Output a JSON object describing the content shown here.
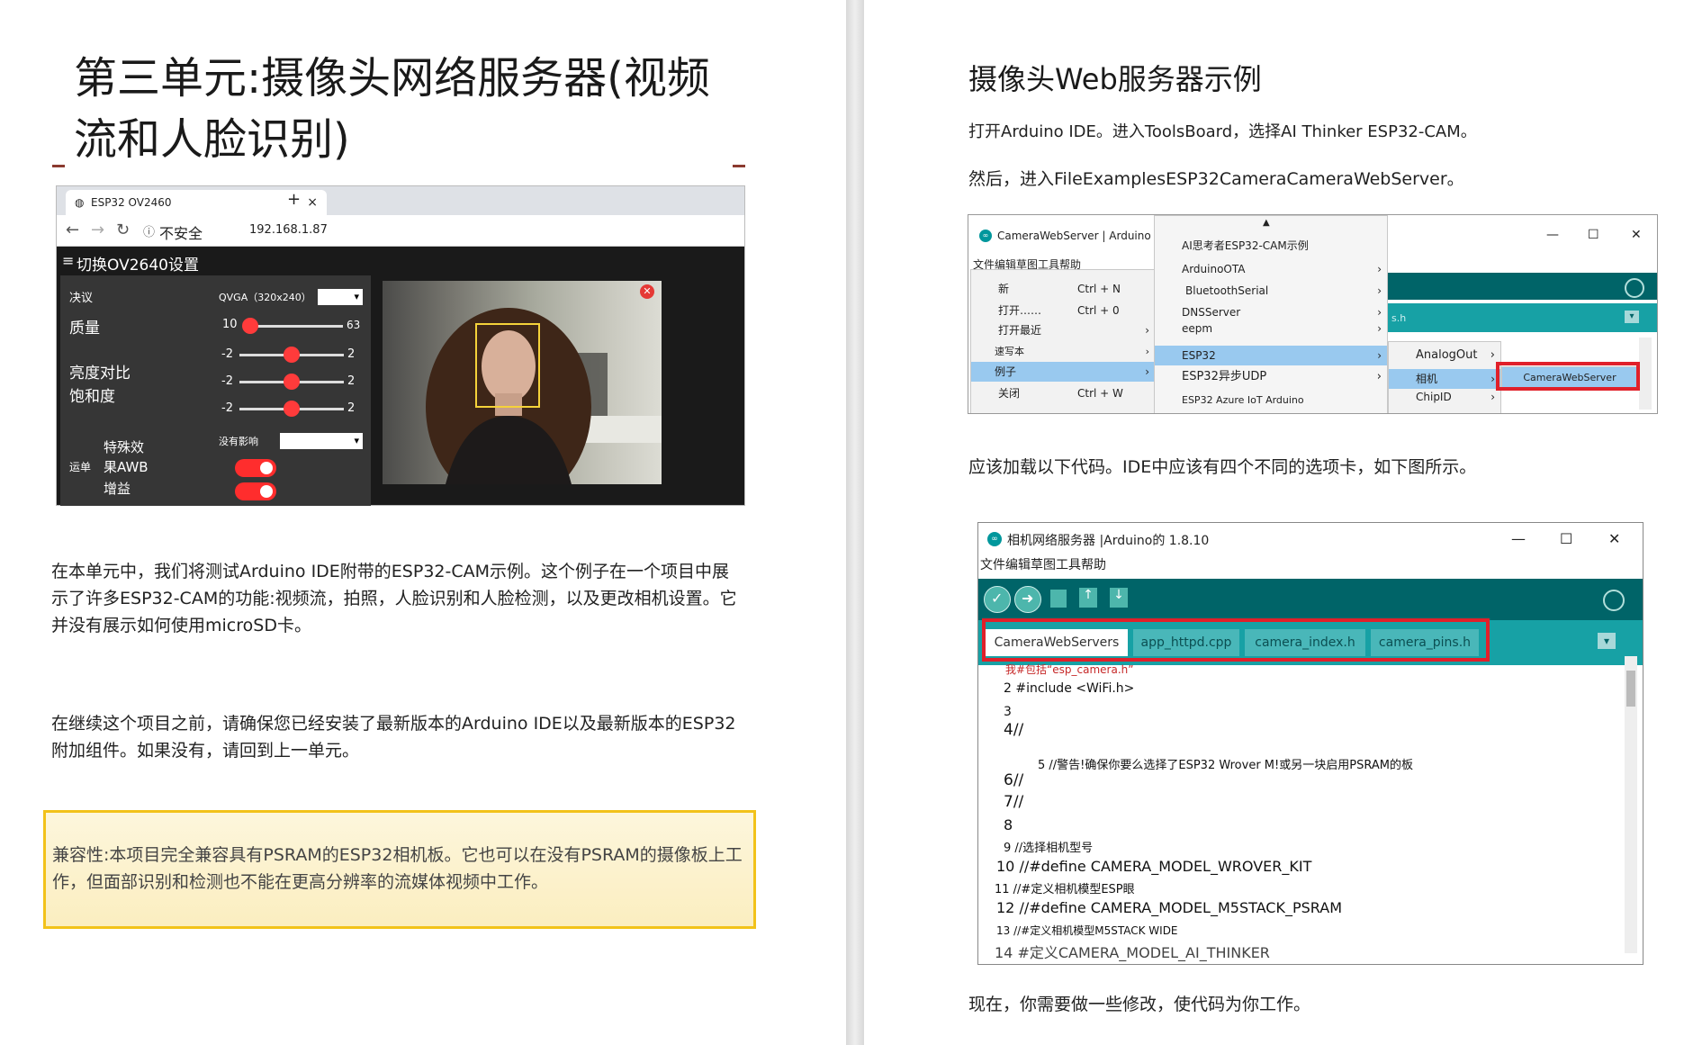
{
  "left": {
    "title_line1": "第三单元:摄像头网络服务器(视频",
    "title_line2": "流和人脸识别)",
    "browser": {
      "tab_title": "ESP32 OV2460",
      "tab_close": "×",
      "tab_add": "+",
      "security_label": "不安全",
      "url": "192.168.1.87",
      "settings_header": "切换OV2640设置",
      "labels": {
        "resolution": "决议",
        "quality": "质量",
        "brightness_contrast": "亮度对比",
        "saturation": "饱和度",
        "special_effects": "特殊效",
        "awb": "果AWB",
        "gain": "增益",
        "side_note": "运单"
      },
      "resolution_value": "QVGA（320x240）",
      "quality_min": "10",
      "quality_max": "63",
      "range_min": "-2",
      "range_max": "2",
      "effect_value": "没有影响",
      "quality_level": 0.05,
      "brightness_level": 0.5,
      "contrast_level": 0.5,
      "saturation_level": 0.5
    },
    "para1": "在本单元中，我们将测试Arduino IDE附带的ESP32-CAM示例。这个例子在一个项目中展示了许多ESP32-CAM的功能:视频流，拍照，人脸识别和人脸检测，以及更改相机设置。它并没有展示如何使用microSD卡。",
    "para2": "在继续这个项目之前，请确保您已经安装了最新版本的Arduino IDE以及最新版本的ESP32附加组件。如果没有，请回到上一单元。",
    "note": "兼容性:本项目完全兼容具有PSRAM的ESP32相机板。它也可以在没有PSRAM的摄像板上工作，但面部识别和检测也不能在更高分辨率的流媒体视频中工作。"
  },
  "right": {
    "title": "摄像头Web服务器示例",
    "step1": "打开Arduino IDE。进入ToolsBoard，选择AI Thinker ESP32-CAM。",
    "step2": "然后，进入FileExamplesESP32CameraCameraWebServer。",
    "ide1": {
      "window_title": "CameraWebServer | Arduino 1 .",
      "menubar": "文件编辑草图工具帮助",
      "file_menu": [
        {
          "label": "新",
          "shortcut": "Ctrl + N"
        },
        {
          "label": "打开……",
          "shortcut": "Ctrl + 0"
        },
        {
          "label": "打开最近",
          "shortcut": ""
        },
        {
          "label": "速写本",
          "shortcut": ""
        },
        {
          "label": "例子",
          "shortcut": ""
        },
        {
          "label": "关闭",
          "shortcut": "Ctrl + W"
        }
      ],
      "examples_menu": [
        "AI思考者ESP32-CAM示例",
        "ArduinoOTA",
        "BluetoothSerial",
        "DNSServer",
        "eepm",
        "ESP32",
        "ESP32异步UDP",
        "ESP32 Azure IoT Arduino"
      ],
      "submenu1": [
        "AnalogOut",
        "相机",
        "ChipID"
      ],
      "submenu2": "CameraWebServer",
      "tab_stub": "s.h",
      "win_min": "—",
      "win_max": "☐",
      "win_close": "✕"
    },
    "step3": "应该加载以下代码。IDE中应该有四个不同的选项卡，如下图所示。",
    "ide2": {
      "window_title": "相机网络服务器 |Arduino的 1.8.10",
      "menubar": "文件编辑草图工具帮助",
      "tabs": [
        "CameraWebServers",
        "app_httpd.cpp",
        "camera_index.h",
        "camera_pins.h"
      ],
      "code": [
        "我#包括“esp_camera.h”",
        "2 #include <WiFi.h>",
        "3",
        "4//",
        "5 //警告!确保你要么选择了ESP32 Wrover M!或另一块启用PSRAM的板",
        "6//",
        "7//",
        "8",
        "9 //选择相机型号",
        "10 //#define CAMERA_MODEL_WROVER_KIT",
        "11 //#定义相机模型ESP眼",
        "12 //#define CAMERA_MODEL_M5STACK_PSRAM",
        "13 //#定义相机模型M5STACK WIDE",
        "14 #定义CAMERA_MODEL_AI_THINKER"
      ],
      "win_min": "—",
      "win_max": "☐",
      "win_close": "✕"
    },
    "step4": "现在，你需要做一些修改，使代码为你工作。"
  },
  "colors": {
    "teal": "#00979c",
    "teal_dark": "#006468",
    "highlight_red": "#e0202a",
    "note_border": "#f2c21a"
  }
}
